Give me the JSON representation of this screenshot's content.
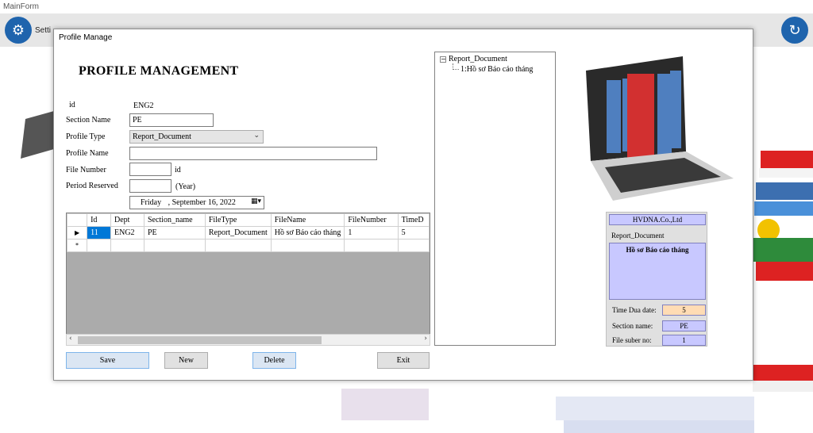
{
  "main": {
    "title": "MainForm",
    "toolbar": [
      {
        "label": "Setti",
        "icon": "gears-icon"
      },
      {
        "label": "",
        "icon": "clipboard-icon"
      },
      {
        "label": "",
        "icon": "database-icon"
      },
      {
        "label": "",
        "icon": "send-icon"
      },
      {
        "label": "",
        "icon": "search-icon"
      },
      {
        "label": "",
        "icon": "redo-icon"
      }
    ]
  },
  "dialog": {
    "title": "Profile Manage",
    "heading": "PROFILE MANAGEMENT",
    "form": {
      "id_label": "id",
      "id_value": "ENG2",
      "section_label": "Section Name",
      "section_value": "PE",
      "profile_type_label": "Profile Type",
      "profile_type_value": "Report_Document",
      "profile_name_label": "Profile Name",
      "profile_name_value": "",
      "file_number_label": "File Number",
      "file_number_value": "",
      "file_number_suffix": "id",
      "period_label": "Period Reserved",
      "period_value": "",
      "period_suffix": "(Year)",
      "date_day": "Friday",
      "date_rest": ", September 16, 2022"
    },
    "grid": {
      "columns": [
        "Id",
        "Dept",
        "Section_name",
        "FileType",
        "FileName",
        "FileNumber",
        "TimeD"
      ],
      "rows": [
        [
          "11",
          "ENG2",
          "PE",
          "Report_Document",
          "Hồ sơ Báo cáo tháng",
          "1",
          "5"
        ]
      ],
      "row_marker": "▶",
      "new_row_marker": "*"
    },
    "buttons": {
      "save": "Save",
      "new": "New",
      "delete": "Delete",
      "exit": "Exit"
    },
    "tree": {
      "root": "Report_Document",
      "expander": "−",
      "child": "1:Hồ sơ Báo cáo tháng"
    },
    "panel": {
      "company": "HVDNA.Co.,Ltd",
      "doc_type": "Report_Document",
      "doc_name": "Hồ sơ Báo cáo tháng",
      "time_label": "Time Dua date:",
      "time_value": "5",
      "section_label": "Section name:",
      "section_value": "PE",
      "file_label": "File suber no:",
      "file_value": "1"
    }
  }
}
